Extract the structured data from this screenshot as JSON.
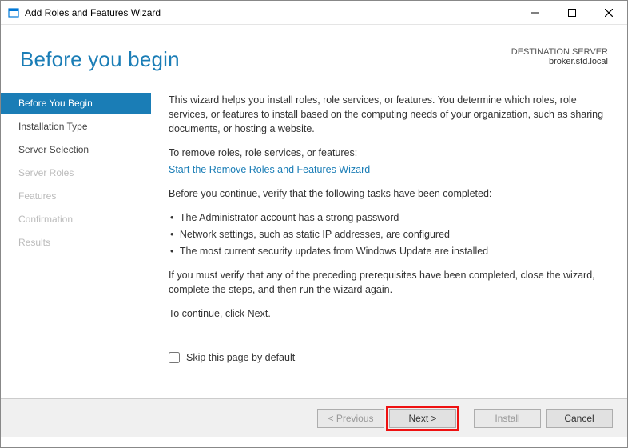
{
  "window": {
    "title": "Add Roles and Features Wizard"
  },
  "header": {
    "title": "Before you begin",
    "dest_label": "DESTINATION SERVER",
    "dest_value": "broker.std.local"
  },
  "sidebar": {
    "items": [
      {
        "label": "Before You Begin",
        "state": "active"
      },
      {
        "label": "Installation Type",
        "state": "enabled"
      },
      {
        "label": "Server Selection",
        "state": "enabled"
      },
      {
        "label": "Server Roles",
        "state": "disabled"
      },
      {
        "label": "Features",
        "state": "disabled"
      },
      {
        "label": "Confirmation",
        "state": "disabled"
      },
      {
        "label": "Results",
        "state": "disabled"
      }
    ]
  },
  "content": {
    "intro": "This wizard helps you install roles, role services, or features. You determine which roles, role services, or features to install based on the computing needs of your organization, such as sharing documents, or hosting a website.",
    "remove_label": "To remove roles, role services, or features:",
    "remove_link": "Start the Remove Roles and Features Wizard",
    "verify_label": "Before you continue, verify that the following tasks have been completed:",
    "bullets": [
      "The Administrator account has a strong password",
      "Network settings, such as static IP addresses, are configured",
      "The most current security updates from Windows Update are installed"
    ],
    "confirm_text": "If you must verify that any of the preceding prerequisites have been completed, close the wizard, complete the steps, and then run the wizard again.",
    "continue_text": "To continue, click Next.",
    "skip_label": "Skip this page by default",
    "skip_checked": false
  },
  "footer": {
    "previous": "< Previous",
    "next": "Next >",
    "install": "Install",
    "cancel": "Cancel"
  }
}
